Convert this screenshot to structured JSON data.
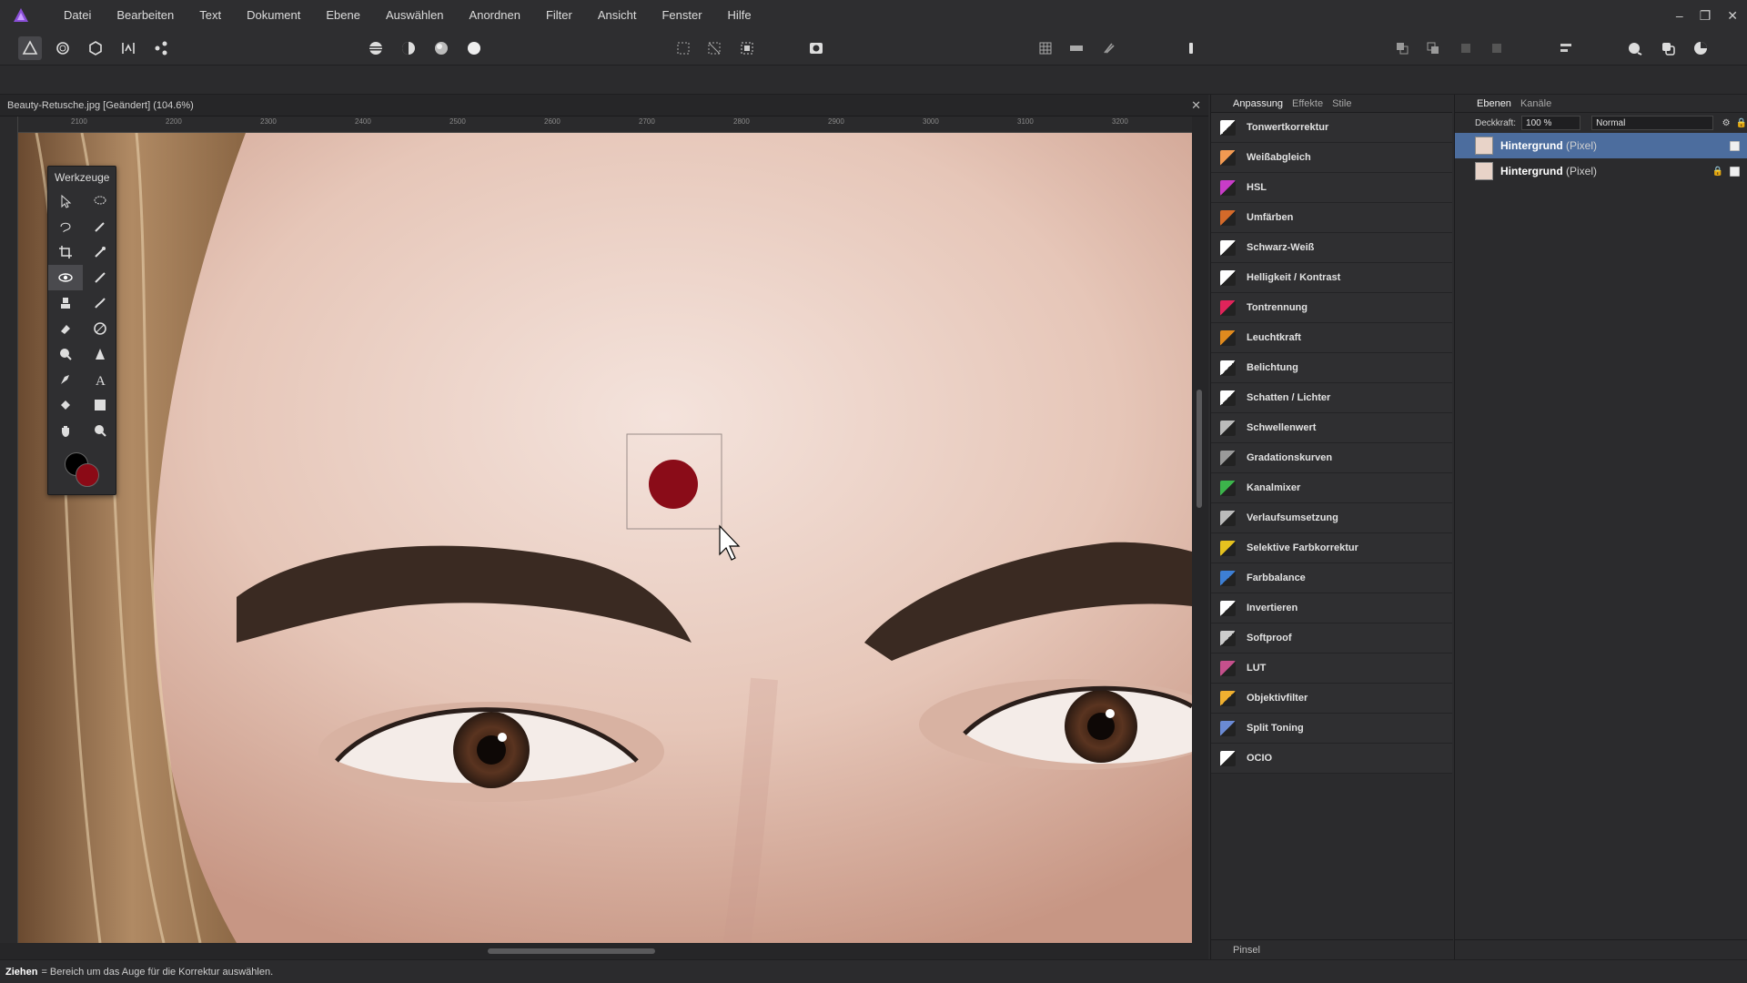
{
  "menu": [
    "Datei",
    "Bearbeiten",
    "Text",
    "Dokument",
    "Ebene",
    "Auswählen",
    "Anordnen",
    "Filter",
    "Ansicht",
    "Fenster",
    "Hilfe"
  ],
  "window_controls": {
    "minimize": "–",
    "restore": "❐",
    "close": "✕"
  },
  "document": {
    "title": "Beauty-Retusche.jpg [Geändert] (104.6%)",
    "close": "✕"
  },
  "ruler_ticks": [
    "2100",
    "2200",
    "2300",
    "2400",
    "2500",
    "2600",
    "2700",
    "2800",
    "2900",
    "3000",
    "3100",
    "3200"
  ],
  "tools_panel": {
    "title": "Werkzeuge"
  },
  "tools": [
    "move-tool",
    "selection-brush-tool",
    "freehand-selection-tool",
    "brush-tool",
    "crop-tool",
    "color-picker-tool",
    "red-eye-tool",
    "paint-brush-tool",
    "clone-tool",
    "smudge-tool",
    "eraser-tool",
    "blemish-tool",
    "dodge-tool",
    "sharpen-tool",
    "pen-tool",
    "text-tool",
    "fill-tool",
    "rectangle-tool",
    "hand-tool",
    "zoom-tool"
  ],
  "colors": {
    "foreground": "#000000",
    "background": "#8b0a16",
    "accent": "#4c6d9e",
    "marker": "#8a0c18"
  },
  "adjustment_tabs": [
    "Anpassung",
    "Effekte",
    "Stile"
  ],
  "adjustments": [
    {
      "label": "Tonwertkorrektur",
      "icon": "levels-icon",
      "color": "#ffffff"
    },
    {
      "label": "Weißabgleich",
      "icon": "white-balance-icon",
      "color": "#f29a52"
    },
    {
      "label": "HSL",
      "icon": "hsl-icon",
      "color": "#c83cc8"
    },
    {
      "label": "Umfärben",
      "icon": "recolor-icon",
      "color": "#d46a2a"
    },
    {
      "label": "Schwarz-Weiß",
      "icon": "black-white-icon",
      "color": "#ffffff"
    },
    {
      "label": "Helligkeit / Kontrast",
      "icon": "brightness-contrast-icon",
      "color": "#ffffff"
    },
    {
      "label": "Tontrennung",
      "icon": "posterize-icon",
      "color": "#e0245a"
    },
    {
      "label": "Leuchtkraft",
      "icon": "vibrance-icon",
      "color": "#e08a1e"
    },
    {
      "label": "Belichtung",
      "icon": "exposure-icon",
      "color": "#ffffff"
    },
    {
      "label": "Schatten / Lichter",
      "icon": "shadows-highlights-icon",
      "color": "#ffffff"
    },
    {
      "label": "Schwellenwert",
      "icon": "threshold-icon",
      "color": "#bbbbbb"
    },
    {
      "label": "Gradationskurven",
      "icon": "curves-icon",
      "color": "#9a9a9a"
    },
    {
      "label": "Kanalmixer",
      "icon": "channel-mixer-icon",
      "color": "#3cb44b"
    },
    {
      "label": "Verlaufsumsetzung",
      "icon": "gradient-map-icon",
      "color": "#bbbbbb"
    },
    {
      "label": "Selektive Farbkorrektur",
      "icon": "selective-color-icon",
      "color": "#e6c21f"
    },
    {
      "label": "Farbbalance",
      "icon": "color-balance-icon",
      "color": "#3d7fd4"
    },
    {
      "label": "Invertieren",
      "icon": "invert-icon",
      "color": "#ffffff"
    },
    {
      "label": "Softproof",
      "icon": "soft-proof-icon",
      "color": "#cccccc"
    },
    {
      "label": "LUT",
      "icon": "lut-icon",
      "color": "#c5508c"
    },
    {
      "label": "Objektivfilter",
      "icon": "lens-filter-icon",
      "color": "#f0b030"
    },
    {
      "label": "Split Toning",
      "icon": "split-toning-icon",
      "color": "#6a8ad4"
    },
    {
      "label": "OCIO",
      "icon": "ocio-icon",
      "color": "#ffffff"
    }
  ],
  "adjust_bottom": "Pinsel",
  "layers_tabs": [
    "Ebenen",
    "Kanäle"
  ],
  "layer_options": {
    "opacity_label": "Deckkraft:",
    "opacity_value": "100 %",
    "blend_mode": "Normal"
  },
  "layers": [
    {
      "name": "Hintergrund",
      "type": "(Pixel)",
      "selected": true
    },
    {
      "name": "Hintergrund",
      "type": "(Pixel)",
      "selected": false
    }
  ],
  "status": {
    "action": "Ziehen",
    "message": "= Bereich um das Auge für die Korrektur auswählen."
  }
}
